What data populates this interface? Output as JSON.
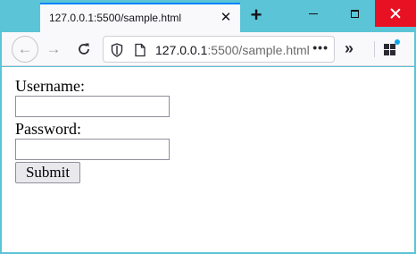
{
  "tab": {
    "title": "127.0.0.1:5500/sample.html",
    "close_glyph": "✕",
    "new_tab_glyph": "+"
  },
  "toolbar": {
    "back_glyph": "←",
    "forward_glyph": "→",
    "url_host": "127.0.0.1",
    "url_rest": ":5500/sample.html",
    "page_actions_glyph": "•••",
    "overflow_glyph": "»"
  },
  "form": {
    "username_label": "Username:",
    "username_value": "",
    "password_label": "Password:",
    "password_value": "",
    "submit_label": "Submit"
  },
  "colors": {
    "window_accent": "#5bc4d6",
    "tab_highlight": "#0a84ff",
    "close_button": "#e81123",
    "extension_badge": "#0ea5e9"
  },
  "icons": [
    "back-arrow-icon",
    "forward-arrow-icon",
    "reload-icon",
    "shield-icon",
    "page-icon",
    "more-dots-icon",
    "chevron-double-right-icon",
    "extensions-icon",
    "close-icon",
    "plus-icon",
    "minimize-icon",
    "maximize-icon"
  ]
}
